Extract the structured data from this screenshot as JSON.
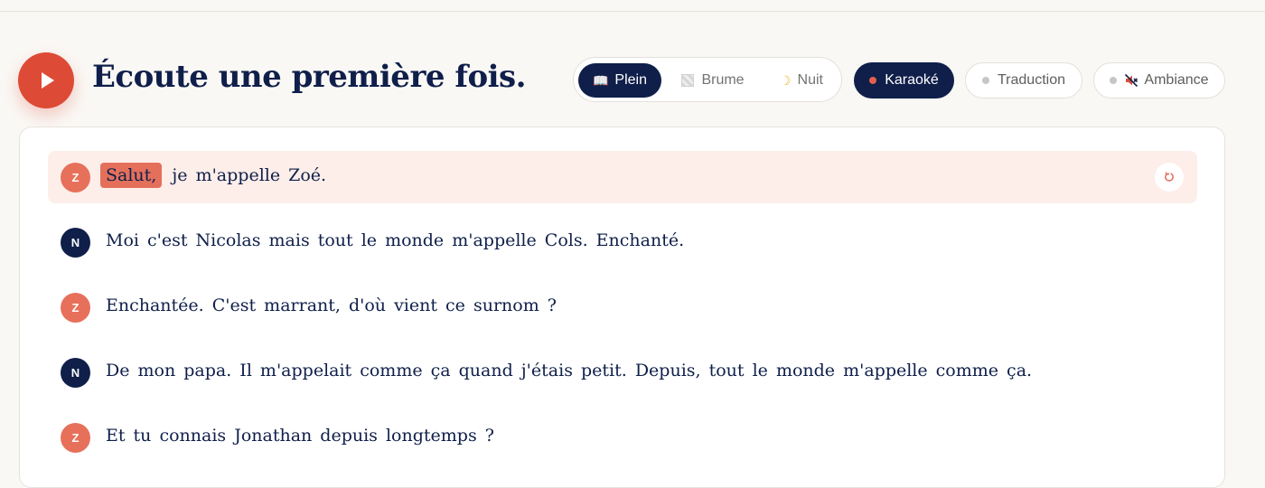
{
  "header": {
    "title": "Écoute une première fois.",
    "play_icon": "play-icon"
  },
  "display_modes": [
    {
      "label": "Plein",
      "icon": "book-icon",
      "active": true
    },
    {
      "label": "Brume",
      "icon": "fog-icon",
      "active": false
    },
    {
      "label": "Nuit",
      "icon": "moon-icon",
      "active": false
    }
  ],
  "toggles": [
    {
      "label": "Karaoké",
      "active": true
    },
    {
      "label": "Traduction",
      "active": false
    },
    {
      "label": "Ambiance",
      "icon": "muted-speaker-icon",
      "active": false
    }
  ],
  "colors": {
    "accent": "#dd4a36",
    "navy": "#0f1f4a",
    "speaker_z": "#e7705b",
    "speaker_n": "#0f1f4a",
    "active_line_bg": "#fdeee9"
  },
  "transcript": [
    {
      "speaker": "Z",
      "highlight": "Salut,",
      "text": "je m'appelle Zoé.",
      "active": true,
      "replay_icon": "replay-icon"
    },
    {
      "speaker": "N",
      "text": "Moi c'est Nicolas mais tout le monde m'appelle Cols. Enchanté."
    },
    {
      "speaker": "Z",
      "text": "Enchantée. C'est marrant, d'où vient ce surnom ?"
    },
    {
      "speaker": "N",
      "text": "De mon papa. Il m'appelait comme ça quand j'étais petit. Depuis, tout le monde m'appelle comme ça."
    },
    {
      "speaker": "Z",
      "text": "Et tu connais Jonathan depuis longtemps ?"
    }
  ]
}
